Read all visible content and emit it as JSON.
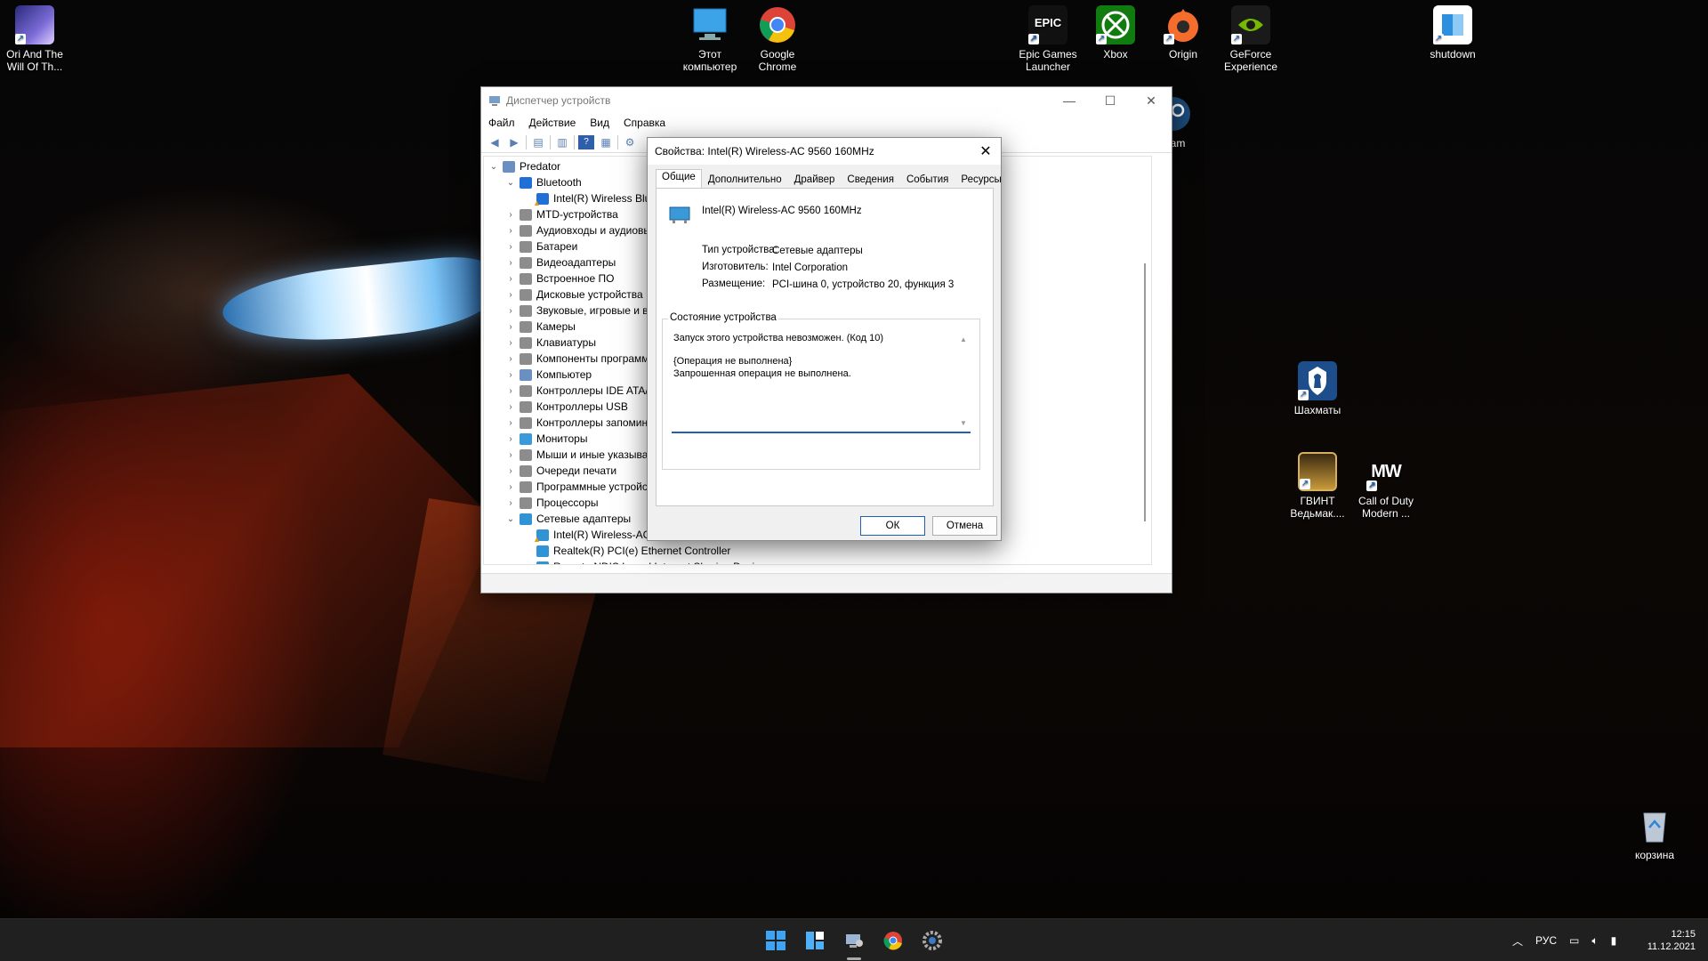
{
  "desktop": {
    "icons": [
      {
        "label": "Ori And The Will Of Th...",
        "icon": "ori-game-icon"
      },
      {
        "label": "Этот компьютер",
        "icon": "monitor-icon"
      },
      {
        "label": "Google Chrome",
        "icon": "chrome-icon"
      },
      {
        "label": "Epic Games Launcher",
        "icon": "epic-games-icon",
        "mark": "EPIC"
      },
      {
        "label": "Xbox",
        "icon": "xbox-icon"
      },
      {
        "label": "Origin",
        "icon": "origin-icon"
      },
      {
        "label": "GeForce Experience",
        "icon": "geforce-icon"
      },
      {
        "label": "shutdown",
        "icon": "shutdown-icon"
      },
      {
        "label": "team",
        "icon": "steam-icon"
      },
      {
        "label": "Шахматы",
        "icon": "chess-icon"
      },
      {
        "label": "ГВИНТ Ведьмак....",
        "icon": "gwent-icon"
      },
      {
        "label": "Call of Duty Modern ...",
        "icon": "call-of-duty-icon",
        "mark": "MW"
      },
      {
        "label": "корзина",
        "icon": "recycle-bin-icon"
      }
    ]
  },
  "device_manager": {
    "title": "Диспетчер устройств",
    "menu": [
      "Файл",
      "Действие",
      "Вид",
      "Справка"
    ],
    "tree": [
      {
        "label": "Predator",
        "expanded": true,
        "level": 0,
        "icon": "computer-icon"
      },
      {
        "label": "Bluetooth",
        "expanded": true,
        "level": 1,
        "icon": "bluetooth-icon"
      },
      {
        "label": "Intel(R) Wireless Blue",
        "level": 2,
        "icon": "bluetooth-warning-icon"
      },
      {
        "label": "MTD-устройства",
        "level": 1,
        "icon": "device-icon"
      },
      {
        "label": "Аудиовходы и аудиовь",
        "level": 1,
        "icon": "audio-icon"
      },
      {
        "label": "Батареи",
        "level": 1,
        "icon": "battery-icon"
      },
      {
        "label": "Видеоадаптеры",
        "level": 1,
        "icon": "display-adapter-icon"
      },
      {
        "label": "Встроенное ПО",
        "level": 1,
        "icon": "firmware-icon"
      },
      {
        "label": "Дисковые устройства",
        "level": 1,
        "icon": "disk-icon"
      },
      {
        "label": "Звуковые, игровые и в",
        "level": 1,
        "icon": "sound-icon"
      },
      {
        "label": "Камеры",
        "level": 1,
        "icon": "camera-icon"
      },
      {
        "label": "Клавиатуры",
        "level": 1,
        "icon": "keyboard-icon"
      },
      {
        "label": "Компоненты программ",
        "level": 1,
        "icon": "software-component-icon"
      },
      {
        "label": "Компьютер",
        "level": 1,
        "icon": "computer-icon"
      },
      {
        "label": "Контроллеры IDE ATA/",
        "level": 1,
        "icon": "ide-icon"
      },
      {
        "label": "Контроллеры USB",
        "level": 1,
        "icon": "usb-icon"
      },
      {
        "label": "Контроллеры запомин",
        "level": 1,
        "icon": "storage-icon"
      },
      {
        "label": "Мониторы",
        "level": 1,
        "icon": "monitor-icon"
      },
      {
        "label": "Мыши и иные указыва",
        "level": 1,
        "icon": "mouse-icon"
      },
      {
        "label": "Очереди печати",
        "level": 1,
        "icon": "printer-icon"
      },
      {
        "label": "Программные устройс",
        "level": 1,
        "icon": "software-device-icon"
      },
      {
        "label": "Процессоры",
        "level": 1,
        "icon": "cpu-icon"
      },
      {
        "label": "Сетевые адаптеры",
        "expanded": true,
        "level": 1,
        "icon": "network-adapter-icon"
      },
      {
        "label": "Intel(R) Wireless-AC",
        "level": 2,
        "icon": "network-warning-icon"
      },
      {
        "label": "Realtek(R) PCI(e) Ethernet Controller",
        "level": 2,
        "icon": "network-adapter-icon"
      },
      {
        "label": "Remote NDIS based Internet Sharing Device",
        "level": 2,
        "icon": "network-adapter-icon"
      }
    ]
  },
  "properties_dialog": {
    "title": "Свойства: Intel(R) Wireless-AC 9560 160MHz",
    "tabs": [
      "Общие",
      "Дополнительно",
      "Драйвер",
      "Сведения",
      "События",
      "Ресурсы"
    ],
    "active_tab": "Общие",
    "device_name": "Intel(R) Wireless-AC 9560 160MHz",
    "props": {
      "type_label": "Тип устройства:",
      "type_value": "Сетевые адаптеры",
      "manufacturer_label": "Изготовитель:",
      "manufacturer_value": "Intel Corporation",
      "location_label": "Размещение:",
      "location_value": "PCI-шина 0, устройство 20, функция 3"
    },
    "status_group": "Состояние устройства",
    "status_lines": [
      "Запуск этого устройства невозможен. (Код 10)",
      "",
      "{Операция не выполнена}",
      "Запрошенная операция не выполнена."
    ],
    "ok": "ОК",
    "cancel": "Отмена"
  },
  "taskbar": {
    "apps": [
      "start-icon",
      "widgets-icon",
      "device-manager-icon",
      "chrome-icon",
      "settings-icon"
    ],
    "language": "РУС",
    "time": "12:15",
    "date": "11.12.2021"
  }
}
